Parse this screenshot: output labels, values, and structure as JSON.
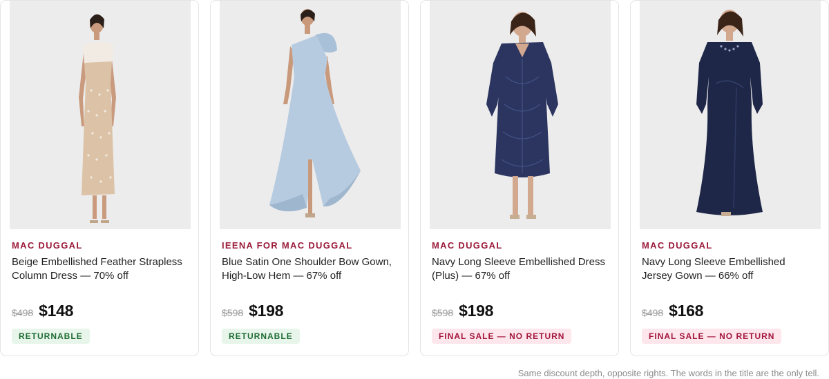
{
  "products": [
    {
      "brand": "MAC DUGGAL",
      "title": "Beige Embellished Feather Strapless Column Dress — 70% off",
      "was": "$498",
      "now": "$148",
      "badge": "RETURNABLE",
      "badge_kind": "ok",
      "dress_color": "#dcc2a6",
      "photo": "beige-column-dress"
    },
    {
      "brand": "IEENA FOR MAC DUGGAL",
      "title": "Blue Satin One Shoulder Bow Gown, High-Low Hem — 67% off",
      "was": "$598",
      "now": "$198",
      "badge": "RETURNABLE",
      "badge_kind": "ok",
      "dress_color": "#b7cbe0",
      "photo": "blue-satin-gown"
    },
    {
      "brand": "MAC DUGGAL",
      "title": "Navy Long Sleeve Embellished Dress (Plus) — 67% off",
      "was": "$598",
      "now": "$198",
      "badge": "FINAL SALE — NO RETURN",
      "badge_kind": "final",
      "dress_color": "#2b3560",
      "photo": "navy-embellished-dress"
    },
    {
      "brand": "MAC DUGGAL",
      "title": "Navy Long Sleeve Embellished Jersey Gown — 66% off",
      "was": "$498",
      "now": "$168",
      "badge": "FINAL SALE — NO RETURN",
      "badge_kind": "final",
      "dress_color": "#1e2748",
      "photo": "navy-jersey-gown"
    }
  ],
  "footnote": "Same discount depth, opposite rights. The words in the title are the only tell.",
  "colors": {
    "brand_text": "#9b1b3a",
    "returnable_bg": "#e7f5ea",
    "returnable_text": "#1e6b33",
    "final_bg": "#fde6ec",
    "final_text": "#a3163b"
  }
}
